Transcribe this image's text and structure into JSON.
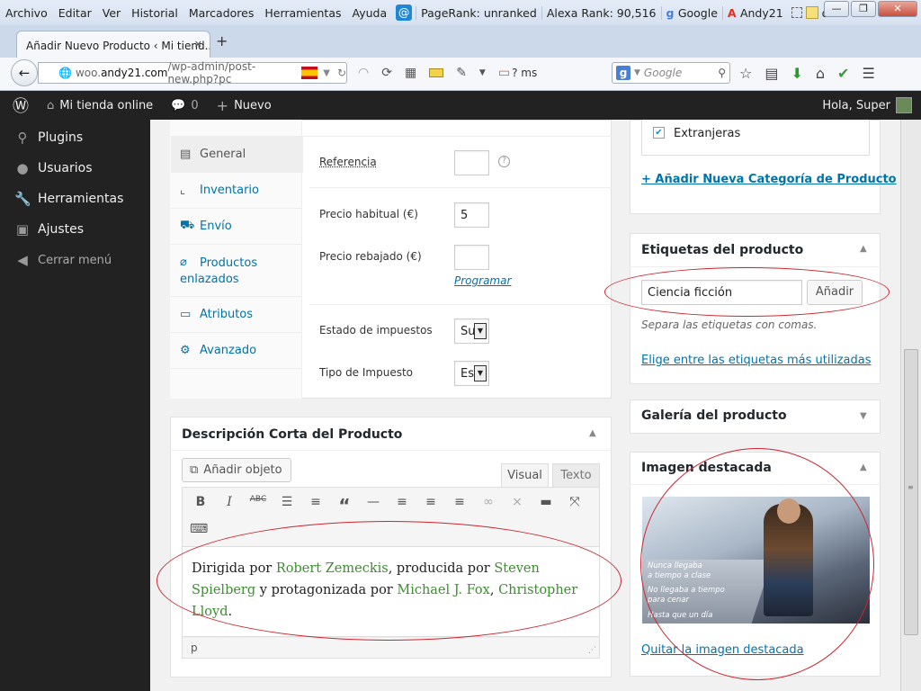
{
  "menubar": {
    "items": [
      "Archivo",
      "Editar",
      "Ver",
      "Historial",
      "Marcadores",
      "Herramientas",
      "Ayuda"
    ],
    "toolbar": {
      "pagerank": "PageRank: unranked",
      "alexa": "Alexa Rank: 90,516",
      "google": "Google",
      "andy": "Andy21",
      "d": "d"
    }
  },
  "tab": {
    "title": "Añadir Nuevo Producto ‹ Mi tiend...",
    "newtab": "+"
  },
  "url": {
    "prefix": "woo.",
    "domain": "andy21.com",
    "path": "/wp-admin/post-new.php?pc"
  },
  "nav": {
    "ms": "? ms",
    "search_placeholder": "Google"
  },
  "adminbar": {
    "site": "Mi tienda online",
    "comments": "0",
    "new": "Nuevo",
    "greeting": "Hola, Super"
  },
  "sidebar": {
    "items": [
      "Plugins",
      "Usuarios",
      "Herramientas",
      "Ajustes",
      "Cerrar menú"
    ]
  },
  "product_data": {
    "tabs": [
      "General",
      "Inventario",
      "Envío",
      "Productos enlazados",
      "Atributos",
      "Avanzado"
    ],
    "referencia": "Referencia",
    "precio_habitual_label": "Precio habitual (€)",
    "precio_habitual_value": "5",
    "precio_rebajado_label": "Precio rebajado (€)",
    "programar": "Programar",
    "estado_label": "Estado de impuestos",
    "estado_value": "Su",
    "tipo_label": "Tipo de Impuesto",
    "tipo_value": "Es"
  },
  "short_desc": {
    "title": "Descripción Corta del Producto",
    "add_media": "Añadir objeto",
    "tab_visual": "Visual",
    "tab_text": "Texto",
    "text": {
      "t1": "Dirigida",
      "t2": " por ",
      "t3": "Robert Zemeckis",
      "t4": ", producida por ",
      "t5": "Steven Spielberg",
      "t6": " y protagonizada por ",
      "t7": "Michael J. Fox",
      "t8": ", ",
      "t9": "Christopher Lloyd",
      "t10": "."
    },
    "path": "p"
  },
  "categories": {
    "extranjeras": "Extranjeras",
    "add_link": "+ Añadir Nueva Categoría de Producto"
  },
  "tags": {
    "title": "Etiquetas del producto",
    "input_value": "Ciencia ficción",
    "add_button": "Añadir",
    "hint": "Separa las etiquetas con comas.",
    "choose_link": "Elige entre las etiquetas más utilizadas"
  },
  "gallery": {
    "title": "Galería del producto"
  },
  "featured": {
    "title": "Imagen destacada",
    "poster_lines": [
      "Nunca llegaba",
      "a tiempo a clase",
      "No llegaba a tiempo",
      "para cenar",
      "Hasta que un día"
    ],
    "remove_link": "Quitar la imagen destacada"
  },
  "colors": {
    "wp_blue": "#0073aa",
    "highlight_red": "#cc2630",
    "admin_bar": "#222222",
    "link_green": "#3b8f2e"
  }
}
